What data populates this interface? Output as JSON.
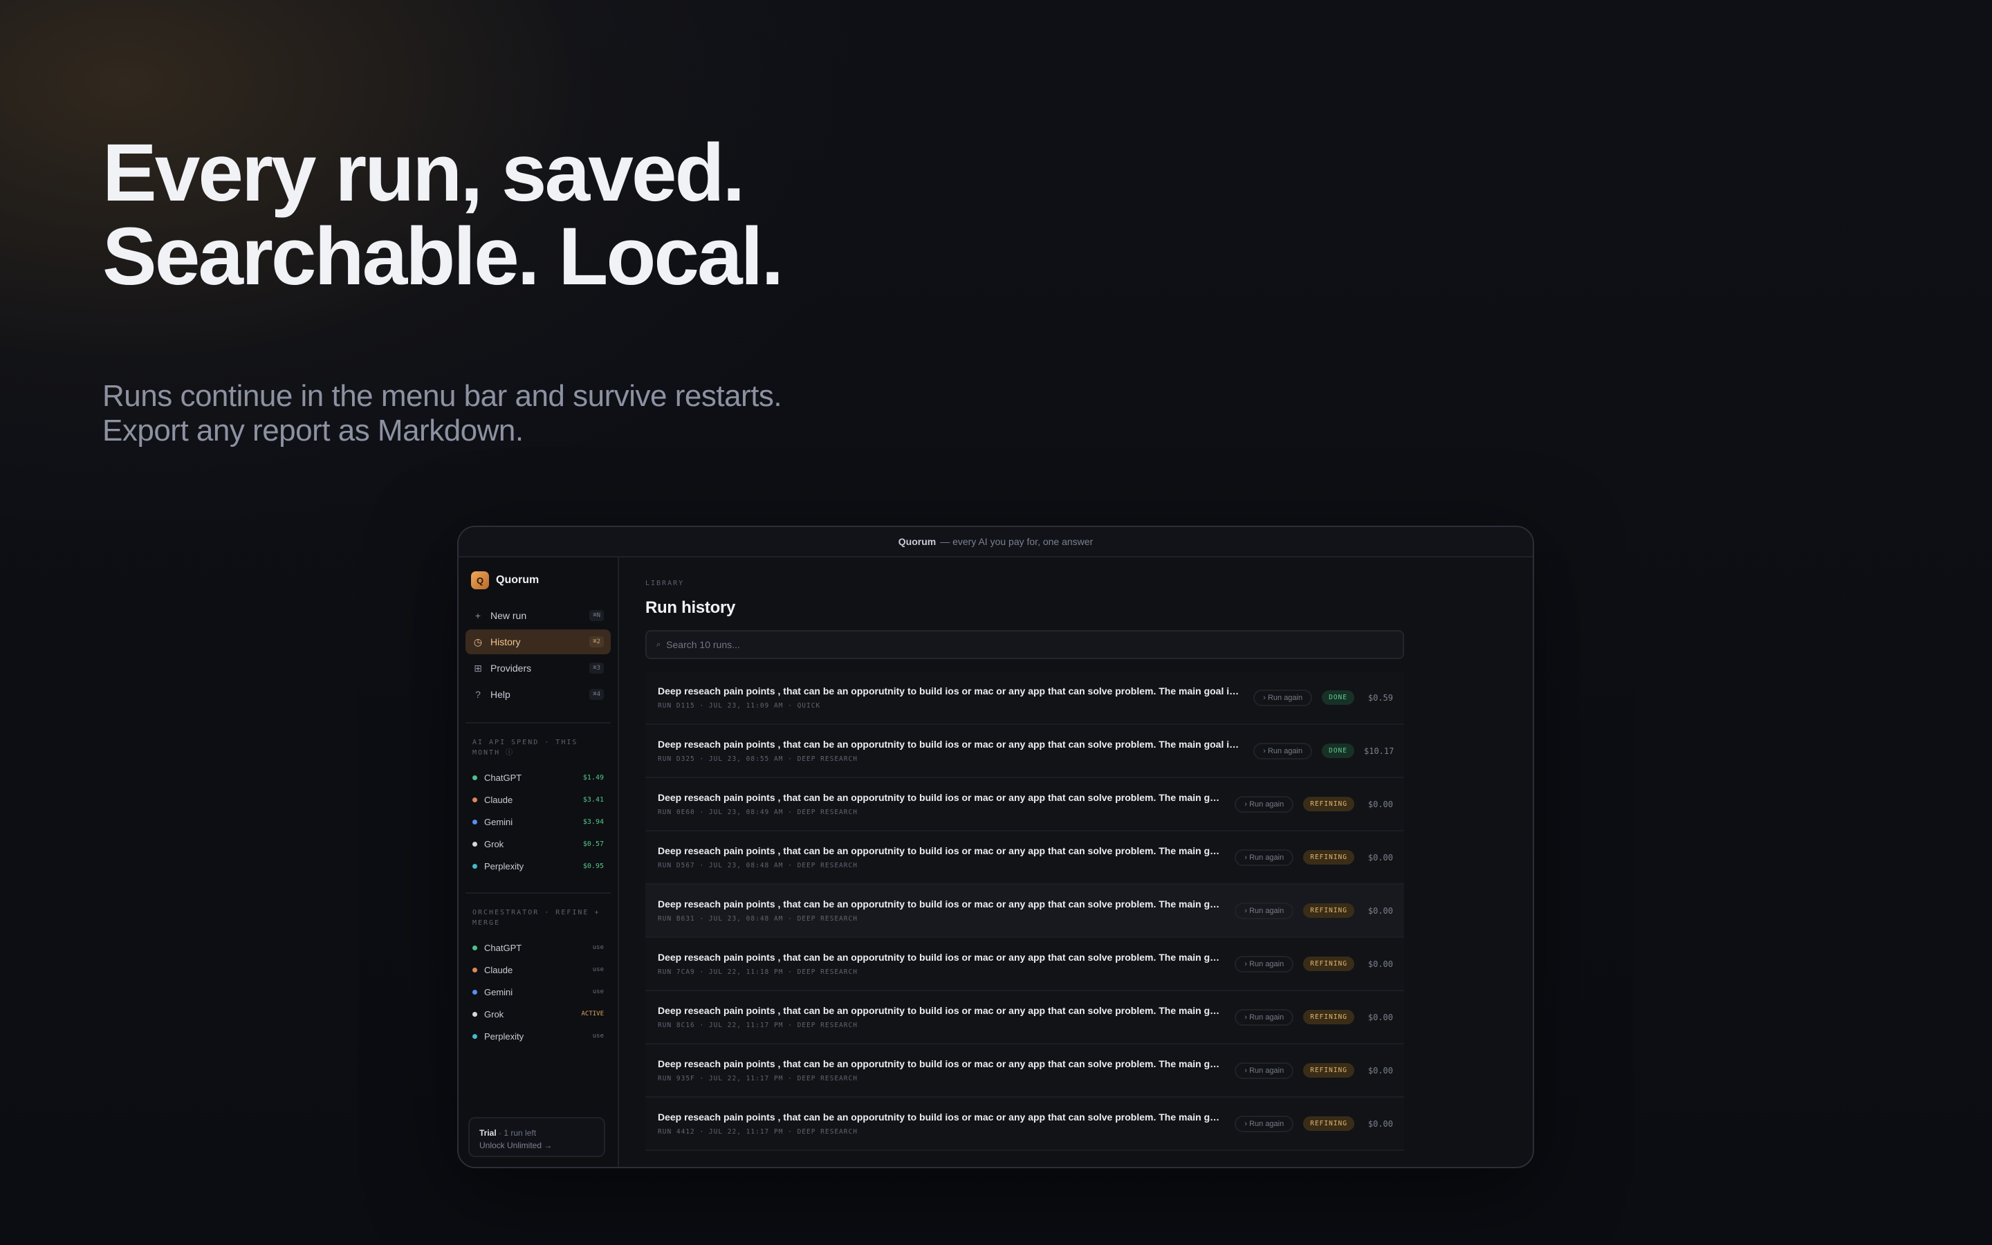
{
  "hero": {
    "title_line1": "Every run, saved.",
    "title_line2": "Searchable. Local.",
    "sub_line1": "Runs continue in the menu bar and survive restarts.",
    "sub_line2": "Export any report as Markdown."
  },
  "window": {
    "app_name": "Quorum",
    "title_rest": "— every AI you pay for, one answer"
  },
  "sidebar": {
    "logo_letter": "Q",
    "brand": "Quorum",
    "nav": [
      {
        "label": "New run",
        "shortcut": "⌘N",
        "icon": "plus-icon"
      },
      {
        "label": "History",
        "shortcut": "⌘2",
        "icon": "clock-icon"
      },
      {
        "label": "Providers",
        "shortcut": "⌘3",
        "icon": "grid-icon"
      },
      {
        "label": "Help",
        "shortcut": "⌘4",
        "icon": "question-icon"
      }
    ],
    "spend_label": "AI API SPEND · THIS MONTH ⓘ",
    "spend": [
      {
        "name": "ChatGPT",
        "value": "$1.49",
        "color": "#4fc08d"
      },
      {
        "name": "Claude",
        "value": "$3.41",
        "color": "#e0875a"
      },
      {
        "name": "Gemini",
        "value": "$3.94",
        "color": "#5b8def"
      },
      {
        "name": "Grok",
        "value": "$0.57",
        "color": "#d5d7dc"
      },
      {
        "name": "Perplexity",
        "value": "$0.95",
        "color": "#46b8c8"
      }
    ],
    "orchestrator_label": "ORCHESTRATOR · REFINE + MERGE",
    "orchestrator": [
      {
        "name": "ChatGPT",
        "state": "use",
        "color": "#4fc08d"
      },
      {
        "name": "Claude",
        "state": "use",
        "color": "#e0875a"
      },
      {
        "name": "Gemini",
        "state": "use",
        "color": "#5b8def"
      },
      {
        "name": "Grok",
        "state": "ACTIVE",
        "color": "#d5d7dc"
      },
      {
        "name": "Perplexity",
        "state": "use",
        "color": "#46b8c8"
      }
    ],
    "trial": {
      "strong": "Trial",
      "rest": " · 1 run left",
      "link": "Unlock Unlimited →"
    }
  },
  "main": {
    "eyebrow": "LIBRARY",
    "title": "Run history",
    "search_placeholder": "Search 10 runs...",
    "run_again_label": "› Run again",
    "runs": [
      {
        "title": "Deep reseach pain points , that can be an opporutnity to build ios or mac or any app that can solve problem. The main goal is to find ideas",
        "meta": "RUN D115 · JUL 23, 11:09 AM · QUICK",
        "status": "DONE",
        "cost": "$0.59"
      },
      {
        "title": "Deep reseach pain points , that can be an opporutnity to build ios or mac or any app that can solve problem. The main goal is to find ideas",
        "meta": "RUN D325 · JUL 23, 08:55 AM · DEEP RESEARCH",
        "status": "DONE",
        "cost": "$10.17"
      },
      {
        "title": "Deep reseach pain points , that can be an opporutnity to build ios or mac or any app that can solve problem. The main goal is to find ideas",
        "meta": "RUN 0E60 · JUL 23, 08:49 AM · DEEP RESEARCH",
        "status": "REFINING",
        "cost": "$0.00"
      },
      {
        "title": "Deep reseach pain points , that can be an opporutnity to build ios or mac or any app that can solve problem. The main goal is to find ideas",
        "meta": "RUN D567 · JUL 23, 08:48 AM · DEEP RESEARCH",
        "status": "REFINING",
        "cost": "$0.00"
      },
      {
        "title": "Deep reseach pain points , that can be an opporutnity to build ios or mac or any app that can solve problem. The main goal is to find ideas",
        "meta": "RUN B631 · JUL 23, 08:48 AM · DEEP RESEARCH",
        "status": "REFINING",
        "cost": "$0.00"
      },
      {
        "title": "Deep reseach pain points , that can be an opporutnity to build ios or mac or any app that can solve problem. The main goal is to find ideas",
        "meta": "RUN 7CA9 · JUL 22, 11:18 PM · DEEP RESEARCH",
        "status": "REFINING",
        "cost": "$0.00"
      },
      {
        "title": "Deep reseach pain points , that can be an opporutnity to build ios or mac or any app that can solve problem. The main goal is to find ideas",
        "meta": "RUN 8C16 · JUL 22, 11:17 PM · DEEP RESEARCH",
        "status": "REFINING",
        "cost": "$0.00"
      },
      {
        "title": "Deep reseach pain points , that can be an opporutnity to build ios or mac or any app that can solve problem. The main goal is to find ideas",
        "meta": "RUN 935F · JUL 22, 11:17 PM · DEEP RESEARCH",
        "status": "REFINING",
        "cost": "$0.00"
      },
      {
        "title": "Deep reseach pain points , that can be an opporutnity to build ios or mac or any app that can solve problem. The main goal is to find ideas",
        "meta": "RUN 4412 · JUL 22, 11:17 PM · DEEP RESEARCH",
        "status": "REFINING",
        "cost": "$0.00"
      }
    ]
  }
}
